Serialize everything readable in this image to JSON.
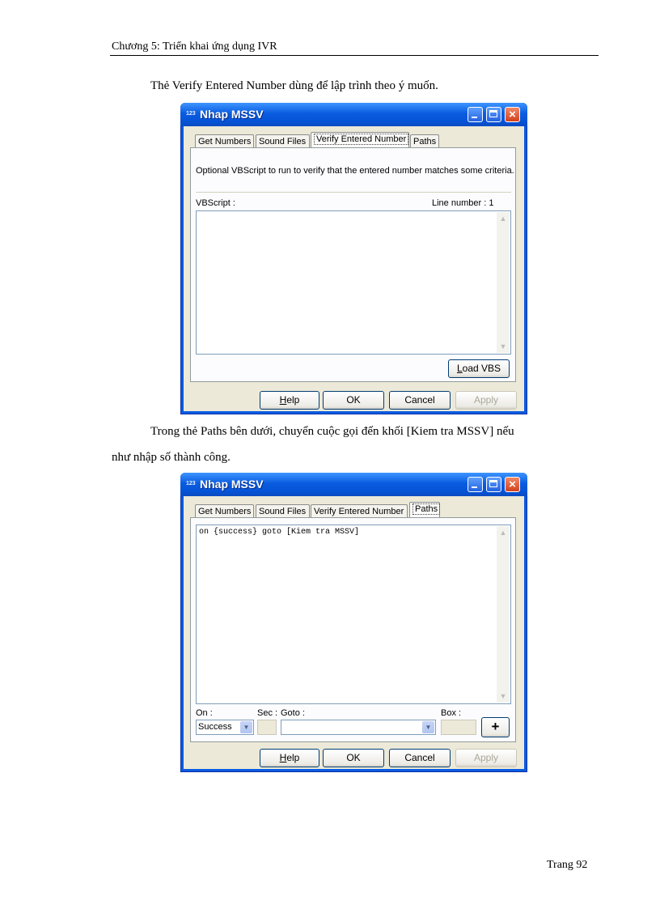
{
  "document": {
    "header": "Chương 5: Triển khai ứng dụng IVR",
    "para1": "Thẻ Verify Entered Number dùng để lập trình theo ý muốn.",
    "para2_line1": "Trong thẻ Paths bên dưới, chuyển cuộc gọi đến khối [Kiem tra MSSV] nếu",
    "para2_line2": "như nhập số thành công.",
    "footer": "Trang 92"
  },
  "dialog1": {
    "title": "Nhap MSSV",
    "app_icon": "123",
    "tabs": [
      "Get Numbers",
      "Sound Files",
      "Verify Entered Number",
      "Paths"
    ],
    "active_tab": "Verify Entered Number",
    "description": "Optional VBScript to run to verify that the entered number matches some criteria.",
    "vbscript_label": "VBScript :",
    "line_number_label": "Line number : 1",
    "load_vbs_prefix": "L",
    "load_vbs_rest": "oad VBS",
    "buttons": {
      "help_prefix": "H",
      "help_rest": "elp",
      "ok": "OK",
      "cancel": "Cancel",
      "apply": "Apply"
    }
  },
  "dialog2": {
    "title": "Nhap MSSV",
    "app_icon": "123",
    "tabs": [
      "Get Numbers",
      "Sound Files",
      "Verify Entered Number",
      "Paths"
    ],
    "active_tab": "Paths",
    "script_text": "on {success} goto [Kiem tra MSSV]",
    "on_label": "On :",
    "sec_label": "Sec :",
    "goto_label": "Goto :",
    "box_label": "Box :",
    "on_value": "Success",
    "add_label": "+",
    "buttons": {
      "help_prefix": "H",
      "help_rest": "elp",
      "ok": "OK",
      "cancel": "Cancel",
      "apply": "Apply"
    }
  }
}
